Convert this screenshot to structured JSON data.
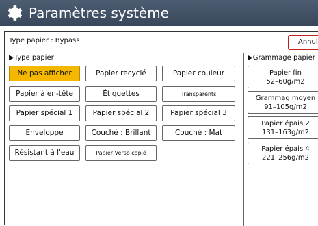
{
  "header": {
    "title": "Paramètres système",
    "icon": "gear-icon"
  },
  "type_bar": {
    "label": "Type papier : Bypass",
    "cancel_label": "Annul"
  },
  "paper_type": {
    "heading": "▶Type papier",
    "selected": "Ne pas afficher",
    "buttons": [
      {
        "label": "Ne pas afficher"
      },
      {
        "label": "Papier recyclé"
      },
      {
        "label": "Papier couleur"
      },
      {
        "label": "Papier à en-tête"
      },
      {
        "label": "Étiquettes"
      },
      {
        "label": "Transparents"
      },
      {
        "label": "Papier spécial 1"
      },
      {
        "label": "Papier spécial 2"
      },
      {
        "label": "Papier spécial 3"
      },
      {
        "label": "Enveloppe"
      },
      {
        "label": "Couché : Brillant"
      },
      {
        "label": "Couché : Mat"
      },
      {
        "label": "Résistant à l'eau"
      },
      {
        "label": "Papier Verso copié"
      }
    ]
  },
  "paper_weight": {
    "heading": "▶Grammage papier",
    "buttons": [
      {
        "line1": "Papier fin",
        "line2": "52–60g/m2"
      },
      {
        "line1": "Grammag moyen",
        "line2": "91–105g/m2"
      },
      {
        "line1": "Papier épais 2",
        "line2": "131–163g/m2"
      },
      {
        "line1": "Papier épais 4",
        "line2": "221–256g/m2"
      }
    ]
  },
  "colors": {
    "title_bar": "#44546a",
    "selected": "#f5b800",
    "cancel_border": "#c21f1f"
  }
}
